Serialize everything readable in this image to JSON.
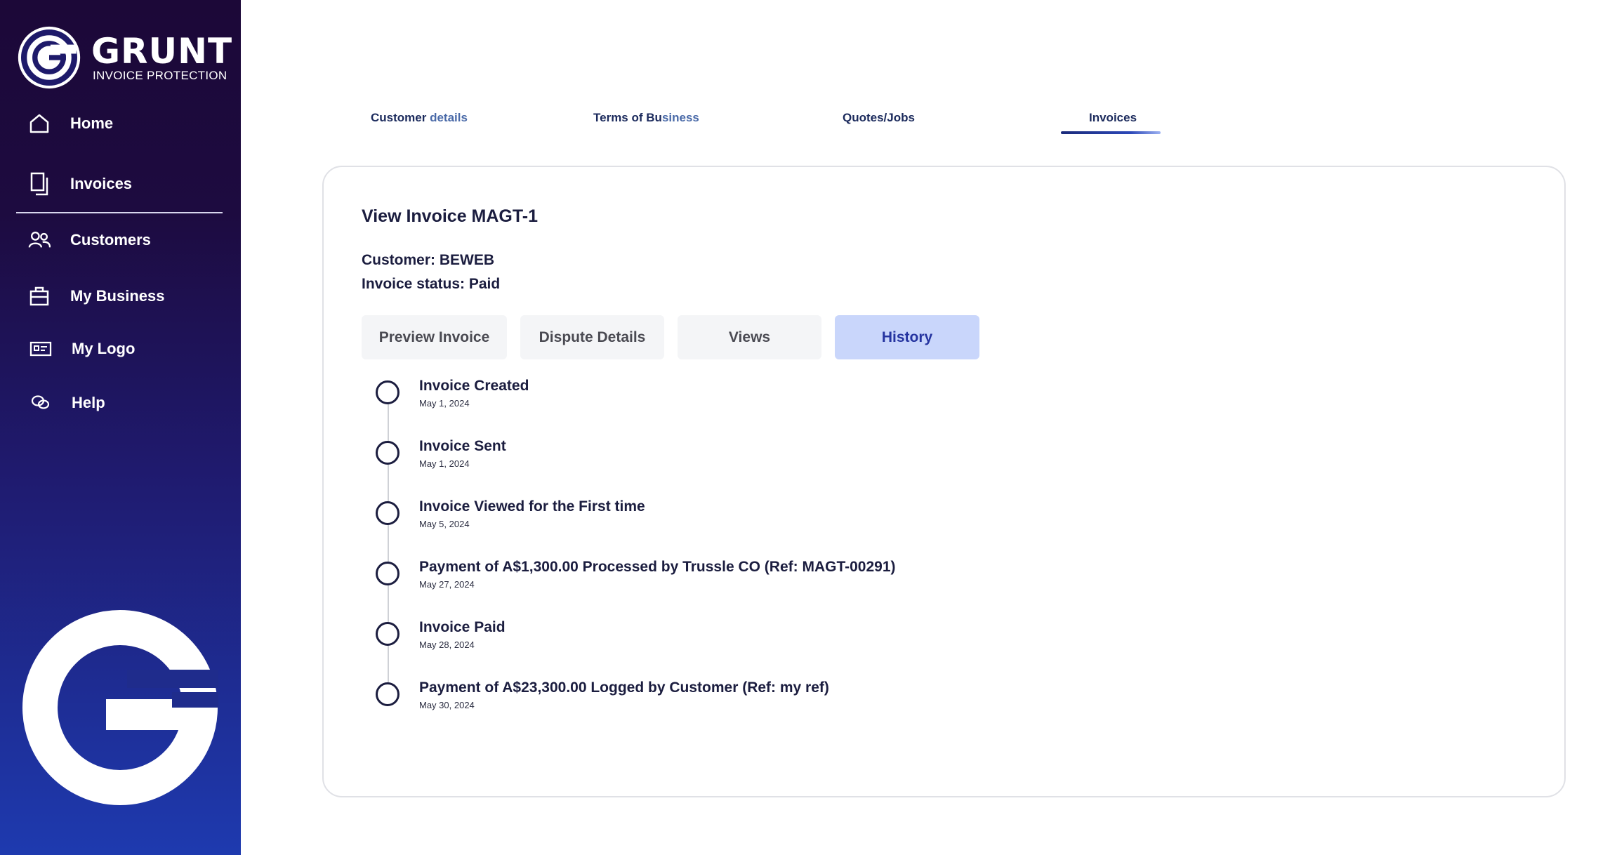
{
  "brand": {
    "name": "GRUNT",
    "tagline": "INVOICE PROTECTION"
  },
  "sidebar": {
    "items": [
      {
        "label": "Home",
        "icon": "home-icon"
      },
      {
        "label": "Invoices",
        "icon": "document-icon"
      },
      {
        "label": "Customers",
        "icon": "users-icon"
      },
      {
        "label": "My Business",
        "icon": "briefcase-icon"
      },
      {
        "label": "My Logo",
        "icon": "id-card-icon"
      },
      {
        "label": "Help",
        "icon": "chat-bubbles-icon"
      }
    ]
  },
  "top_tabs": {
    "customer_details_a": "Customer ",
    "customer_details_b": "details",
    "terms_a": "Terms of ",
    "terms_b": "Bu",
    "terms_c": "siness",
    "quotes": "Quotes/Jobs",
    "invoices": "Invoices",
    "active": "Invoices"
  },
  "card": {
    "title": "View Invoice MAGT-1",
    "customer": "Customer: BEWEB",
    "status": "Invoice status: Paid"
  },
  "segments": {
    "preview": "Preview Invoice",
    "dispute": "Dispute Details",
    "views": "Views",
    "history": "History",
    "active": "History"
  },
  "history": [
    {
      "title": "Invoice Created",
      "date": "May 1, 2024"
    },
    {
      "title": "Invoice Sent",
      "date": "May 1, 2024"
    },
    {
      "title": "Invoice Viewed for the First time",
      "date": "May 5, 2024"
    },
    {
      "title": "Payment of A$1,300.00 Processed by Trussle CO (Ref: MAGT-00291)",
      "date": "May 27, 2024"
    },
    {
      "title": "Invoice Paid",
      "date": "May 28, 2024"
    },
    {
      "title": "Payment of A$23,300.00 Logged by Customer (Ref: my ref)",
      "date": "May 30, 2024"
    }
  ],
  "colors": {
    "sidebar_top": "#1c0838",
    "sidebar_bottom": "#1e3aaf",
    "active_segment_bg": "#c9d6fb",
    "active_segment_text": "#2534a0"
  }
}
